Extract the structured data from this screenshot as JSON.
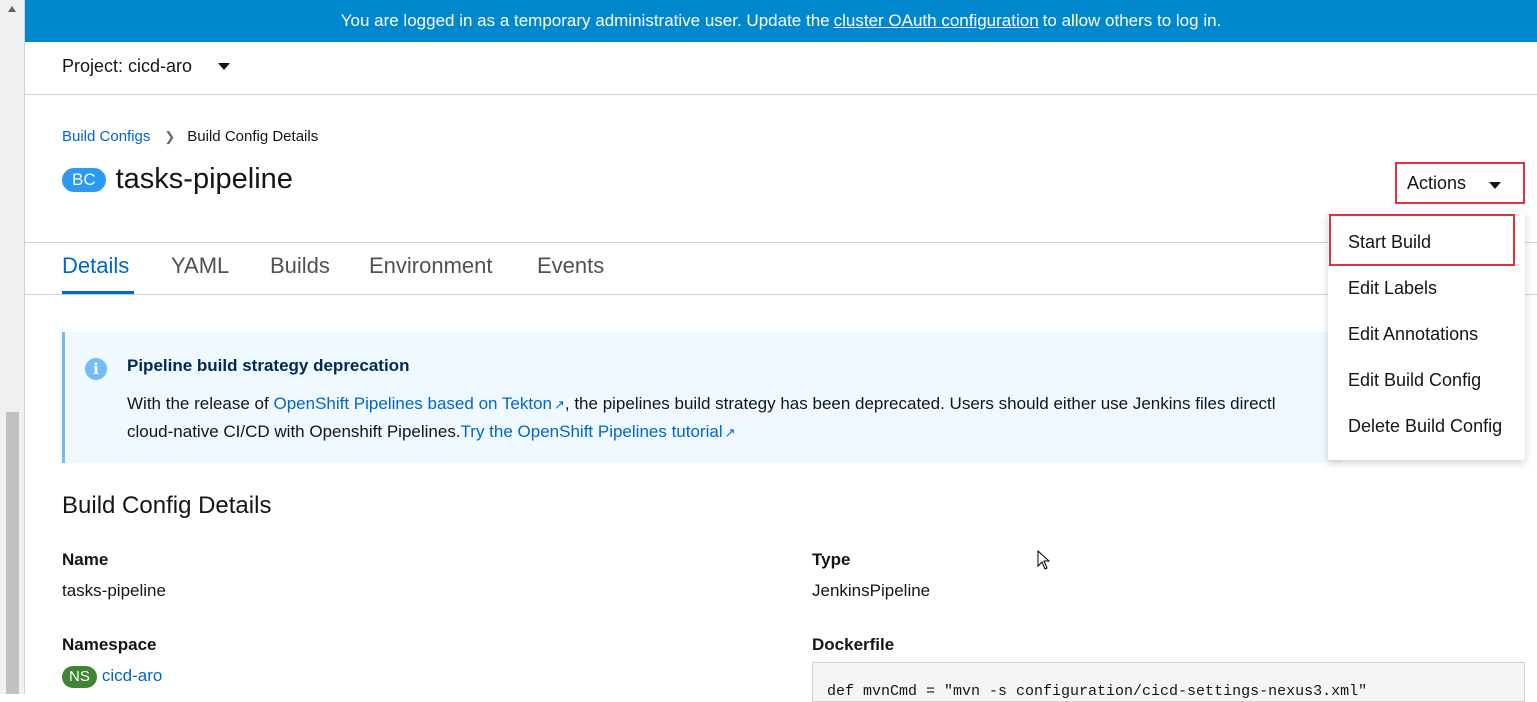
{
  "banner": {
    "text_before": "You are logged in as a temporary administrative user. Update the",
    "link": "cluster OAuth configuration",
    "text_after": "to allow others to log in."
  },
  "project": {
    "label": "Project: cicd-aro"
  },
  "breadcrumb": {
    "parent": "Build Configs",
    "current": "Build Config Details"
  },
  "header": {
    "badge": "BC",
    "title": "tasks-pipeline",
    "actions_label": "Actions"
  },
  "tabs": [
    {
      "label": "Details"
    },
    {
      "label": "YAML"
    },
    {
      "label": "Builds"
    },
    {
      "label": "Environment"
    },
    {
      "label": "Events"
    }
  ],
  "alert": {
    "title": "Pipeline build strategy deprecation",
    "line1_prefix": "With the release of",
    "link1": "OpenShift Pipelines based on Tekton",
    "line1_suffix": ", the pipelines build strategy has been deprecated. Users should either use Jenkins files directl",
    "line2_prefix": "cloud-native CI/CD with Openshift Pipelines.",
    "link2": "Try the OpenShift Pipelines tutorial"
  },
  "details": {
    "section_title": "Build Config Details",
    "name_label": "Name",
    "name_value": "tasks-pipeline",
    "namespace_label": "Namespace",
    "namespace_badge": "NS",
    "namespace_value": "cicd-aro",
    "type_label": "Type",
    "type_value": "JenkinsPipeline",
    "dockerfile_label": "Dockerfile",
    "dockerfile_code": "def mvnCmd = \"mvn -s configuration/cicd-settings-nexus3.xml\""
  },
  "actions_menu": {
    "items": [
      {
        "label": "Start Build"
      },
      {
        "label": "Edit Labels"
      },
      {
        "label": "Edit Annotations"
      },
      {
        "label": "Edit Build Config"
      },
      {
        "label": "Delete Build Config"
      }
    ]
  },
  "colors": {
    "banner_bg": "#0088ce",
    "link": "#0066cc",
    "highlight_box": "#e0323c",
    "alert_bg": "#f0f9ff",
    "bc_badge": "#2b9af3",
    "ns_badge": "#3e8635"
  }
}
